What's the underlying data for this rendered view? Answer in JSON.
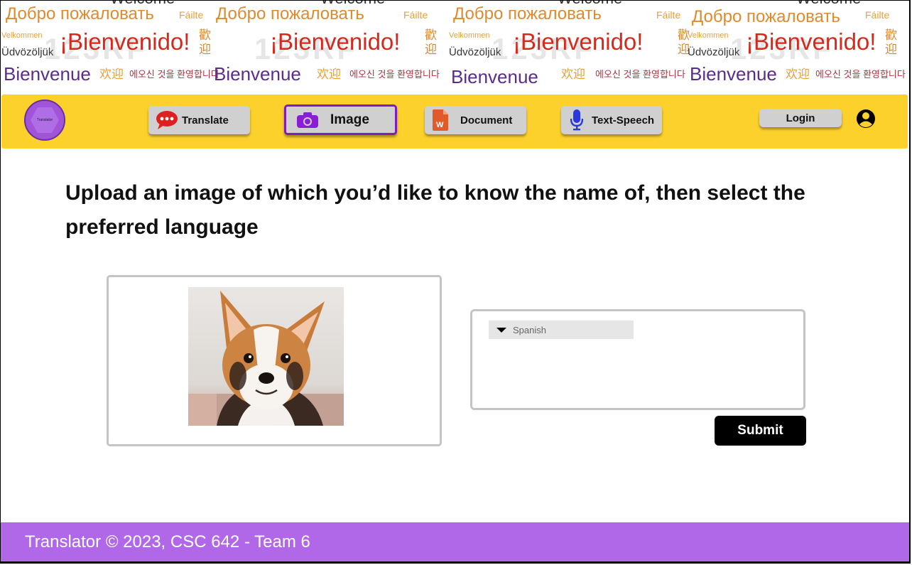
{
  "banner": {
    "welcome": "Welcome",
    "russian": "Добро пожаловать",
    "irish": "Fáilte",
    "danish": "Velkommen",
    "hungarian": "Üdvözöljük",
    "spanish": "¡Bienvenido!",
    "chinese_traditional": "歡迎",
    "french": "Bienvenue",
    "chinese_simplified": "欢迎",
    "korean": "에오신 것을 환영합니다",
    "watermark": "123RF"
  },
  "nav": {
    "logo_text": "Translator",
    "buttons": [
      {
        "label": "Translate",
        "icon": "chat-bubble-icon",
        "color": "#e02020"
      },
      {
        "label": "Image",
        "icon": "camera-icon",
        "color": "#8a1ed8"
      },
      {
        "label": "Document",
        "icon": "document-icon",
        "color": "#e05a2a"
      },
      {
        "label": "Text-Speech",
        "icon": "microphone-icon",
        "color": "#2a38e0"
      }
    ],
    "active": "Image",
    "login_label": "Login"
  },
  "main": {
    "heading": "Upload an image of which you’d like to know the name of, then select the preferred language",
    "uploaded_image": "corgi dog photo",
    "language_select": {
      "selected": "Spanish"
    },
    "submit_label": "Submit"
  },
  "footer": {
    "text": "Translator ©  2023, CSC 642 - Team 6"
  },
  "colors": {
    "navbar": "#fdd12c",
    "footer": "#b168e8",
    "active_border": "#7a20b8",
    "button_bg": "#d0d0d0"
  }
}
